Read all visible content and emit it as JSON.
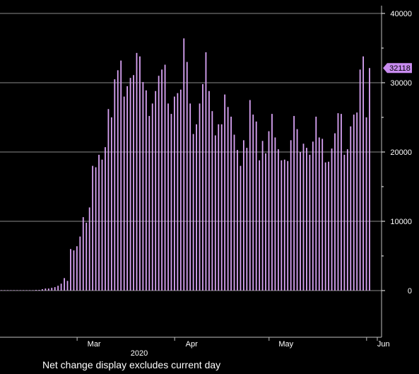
{
  "chart_data": {
    "type": "bar",
    "year_label": "2020",
    "x_month_labels": [
      "Mar",
      "Apr",
      "May",
      "Jun"
    ],
    "y_ticks": [
      0,
      10000,
      20000,
      30000,
      40000
    ],
    "ylim": [
      -5000,
      40000
    ],
    "last_value_label": "32118",
    "grid": true,
    "colors": {
      "bar": "#d9a3f5",
      "badge": "#c98cf0",
      "grid": "#8a8a8a",
      "background": "#000000"
    },
    "values": [
      0,
      0,
      0,
      0,
      0,
      0,
      0,
      0,
      0,
      0,
      0,
      100,
      100,
      200,
      300,
      300,
      400,
      500,
      700,
      1000,
      1800,
      1400,
      6000,
      5800,
      6400,
      7800,
      10600,
      9800,
      12000,
      18000,
      17800,
      19600,
      18900,
      20700,
      26200,
      25000,
      30500,
      31800,
      33200,
      28000,
      29500,
      30700,
      31100,
      34300,
      33800,
      30100,
      28900,
      25200,
      27000,
      28800,
      31000,
      31900,
      32600,
      27000,
      25500,
      28000,
      28500,
      29000,
      36400,
      33000,
      27000,
      22600,
      24000,
      27000,
      29800,
      34400,
      28800,
      25900,
      22400,
      24000,
      24000,
      28300,
      26500,
      25100,
      22500,
      20300,
      18000,
      21700,
      20600,
      27500,
      25400,
      24400,
      18800,
      21600,
      19800,
      23000,
      25500,
      22100,
      20400,
      18800,
      18900,
      18700,
      21700,
      25200,
      23300,
      20000,
      21200,
      20600,
      19600,
      21500,
      25100,
      22100,
      21900,
      18500,
      18600,
      20500,
      22700,
      25600,
      25500,
      19600,
      20400,
      23700,
      25400,
      25700,
      31900,
      33800,
      25000,
      32118
    ]
  },
  "footer": {
    "note": "Net change display excludes current day"
  }
}
